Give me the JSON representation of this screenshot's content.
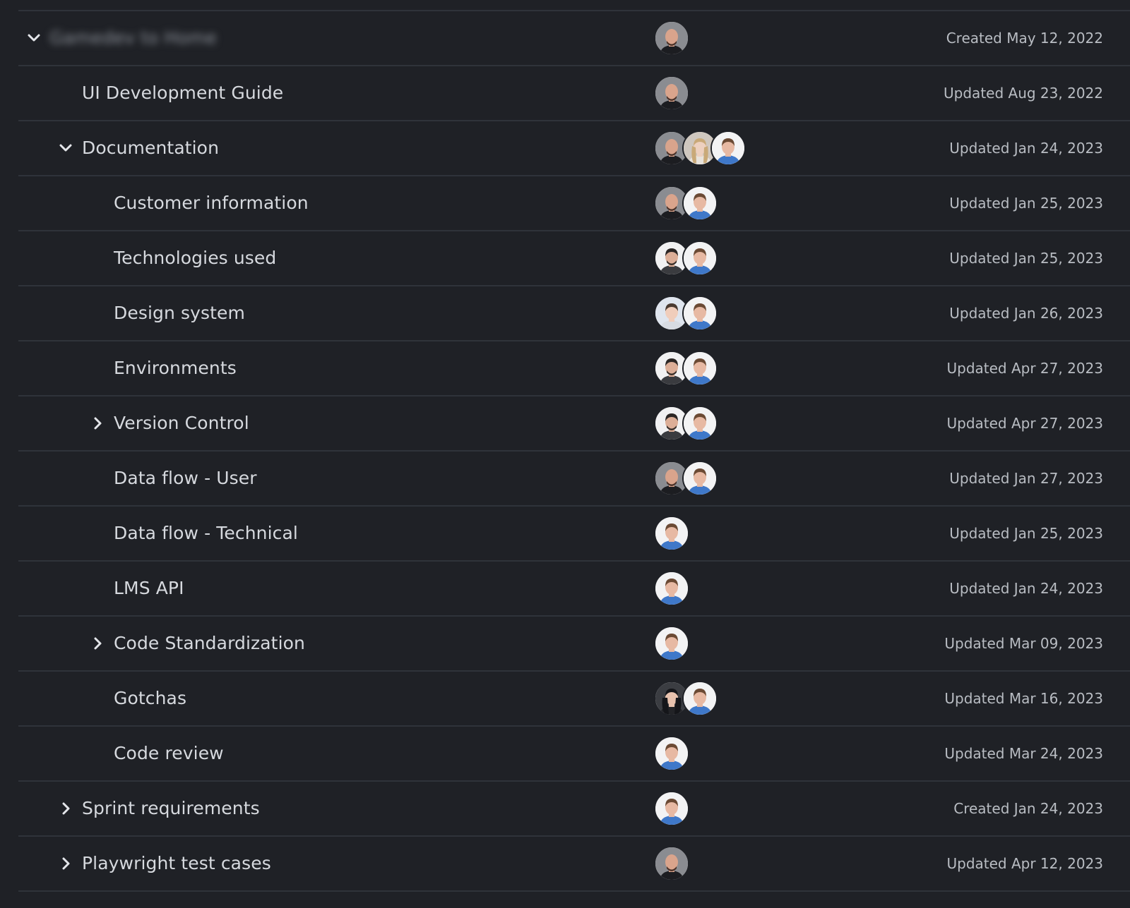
{
  "root": {
    "title": "Gamedev to Home",
    "status": "Created May 12, 2022",
    "expanded": true,
    "avatars": [
      "bald-beard-avatar"
    ]
  },
  "rows": [
    {
      "title": "UI Development Guide",
      "status": "Updated Aug 23, 2022",
      "level": 1,
      "chevron": "none",
      "avatars": [
        "bald-beard-avatar"
      ]
    },
    {
      "title": "Documentation",
      "status": "Updated Jan 24, 2023",
      "level": 1,
      "chevron": "down",
      "avatars": [
        "bald-beard-avatar",
        "blonde-woman-avatar",
        "blue-shirt-man-avatar"
      ]
    },
    {
      "title": "Customer information",
      "status": "Updated Jan 25, 2023",
      "level": 2,
      "chevron": "none",
      "avatars": [
        "bald-beard-avatar",
        "blue-shirt-man-avatar"
      ]
    },
    {
      "title": "Technologies used",
      "status": "Updated Jan 25, 2023",
      "level": 2,
      "chevron": "none",
      "avatars": [
        "dark-hair-beard-avatar",
        "blue-shirt-man-avatar"
      ]
    },
    {
      "title": "Design system",
      "status": "Updated Jan 26, 2023",
      "level": 2,
      "chevron": "none",
      "avatars": [
        "young-man-avatar",
        "blue-shirt-man-avatar"
      ]
    },
    {
      "title": "Environments",
      "status": "Updated Apr 27, 2023",
      "level": 2,
      "chevron": "none",
      "avatars": [
        "dark-hair-beard-avatar",
        "blue-shirt-man-avatar"
      ]
    },
    {
      "title": "Version Control",
      "status": "Updated Apr 27, 2023",
      "level": 2,
      "chevron": "right",
      "avatars": [
        "dark-hair-beard-avatar",
        "blue-shirt-man-avatar"
      ]
    },
    {
      "title": "Data flow - User",
      "status": "Updated Jan 27, 2023",
      "level": 2,
      "chevron": "none",
      "avatars": [
        "bald-beard-avatar",
        "blue-shirt-man-avatar"
      ]
    },
    {
      "title": "Data flow - Technical",
      "status": "Updated Jan 25, 2023",
      "level": 2,
      "chevron": "none",
      "avatars": [
        "blue-shirt-man-avatar"
      ]
    },
    {
      "title": "LMS API",
      "status": "Updated Jan 24, 2023",
      "level": 2,
      "chevron": "none",
      "avatars": [
        "blue-shirt-man-avatar"
      ]
    },
    {
      "title": "Code Standardization",
      "status": "Updated Mar 09, 2023",
      "level": 2,
      "chevron": "right",
      "avatars": [
        "blue-shirt-man-avatar"
      ]
    },
    {
      "title": "Gotchas",
      "status": "Updated Mar 16, 2023",
      "level": 2,
      "chevron": "none",
      "avatars": [
        "dark-hair-woman-avatar",
        "blue-shirt-man-avatar"
      ]
    },
    {
      "title": "Code review",
      "status": "Updated Mar 24, 2023",
      "level": 2,
      "chevron": "none",
      "avatars": [
        "blue-shirt-man-avatar"
      ]
    },
    {
      "title": "Sprint requirements",
      "status": "Created Jan 24, 2023",
      "level": 1,
      "chevron": "right",
      "avatars": [
        "blue-shirt-man-avatar"
      ]
    },
    {
      "title": "Playwright test cases",
      "status": "Updated Apr 12, 2023",
      "level": 1,
      "chevron": "right",
      "avatars": [
        "bald-beard-avatar"
      ]
    }
  ],
  "colors": {
    "background": "#1f2126",
    "divider": "#2f333a",
    "title_text": "#d6d9de",
    "date_text": "#b9bdc3",
    "chevron": "#e4e6ea"
  }
}
